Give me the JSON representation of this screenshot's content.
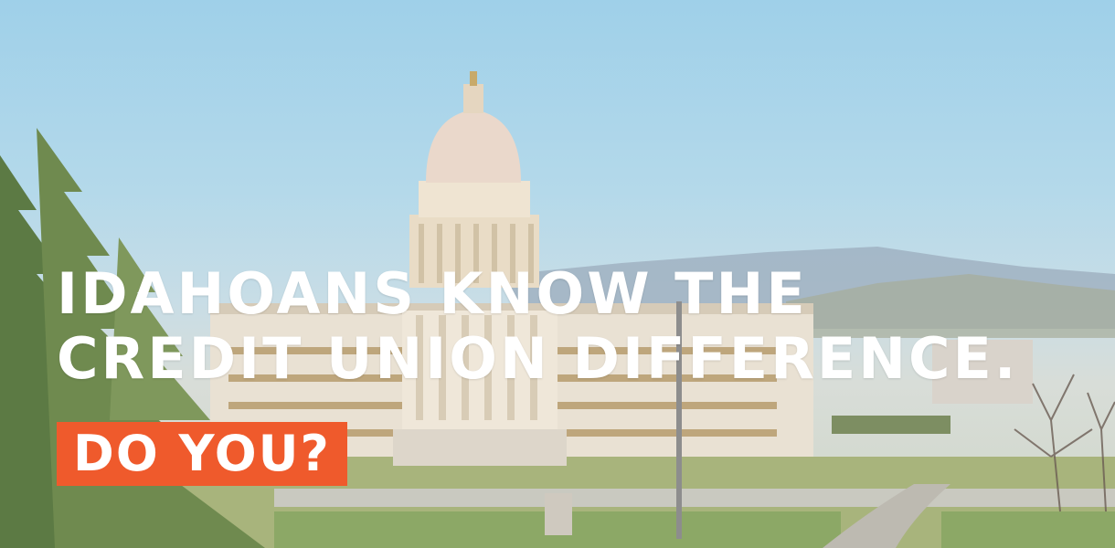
{
  "hero": {
    "headline_line1": "IDAHOANS KNOW THE",
    "headline_line2": "CREDIT UNION DIFFERENCE.",
    "cta": "DO YOU?"
  },
  "colors": {
    "badge": "#ef5a2c",
    "text": "#ffffff",
    "sky": "#a9d4ea"
  }
}
